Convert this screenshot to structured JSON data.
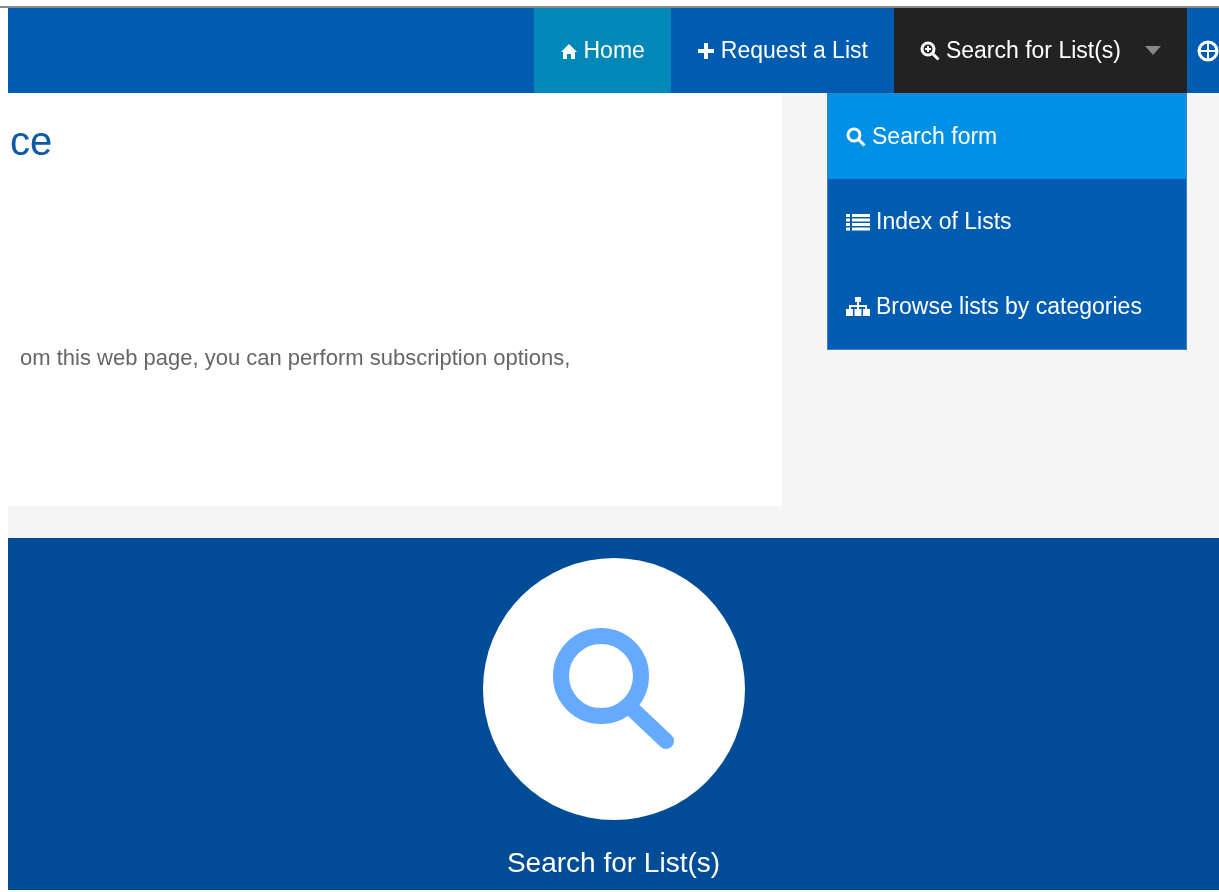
{
  "navbar": {
    "items": [
      {
        "label": "Home",
        "kind": "home",
        "selected": true,
        "expanded": false
      },
      {
        "label": "Request a List",
        "kind": "plus",
        "selected": false,
        "expanded": false
      },
      {
        "label": "Search for List(s)",
        "kind": "zoom",
        "selected": false,
        "expanded": true
      }
    ]
  },
  "dropdown": {
    "items": [
      {
        "label": "Search form",
        "kind": "search",
        "selected": true
      },
      {
        "label": "Index of Lists",
        "kind": "list",
        "selected": false
      },
      {
        "label": "Browse lists by categories",
        "kind": "sitemap",
        "selected": false
      }
    ]
  },
  "panel": {
    "title": "ce",
    "text": "om this web page, you can perform subscription options,"
  },
  "feature": {
    "label": "Search for List(s)"
  }
}
